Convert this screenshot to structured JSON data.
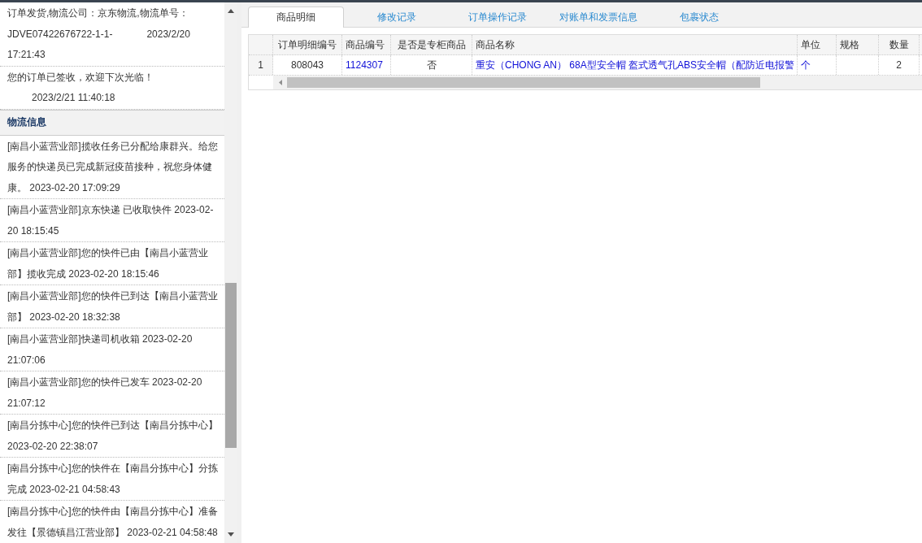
{
  "order_log": [
    {
      "text": "订单发货,物流公司：京东物流,物流单号：JDVE07422676722-1-1-",
      "time": "2023/2/20 17:21:43",
      "kind": "inline"
    },
    {
      "text": "您的订单已签收，欢迎下次光临！",
      "time": "2023/2/21 11:40:18",
      "kind": "block"
    }
  ],
  "logistics": {
    "title": "物流信息",
    "entries": [
      "[南昌小蓝营业部]揽收任务已分配给康群兴。给您服务的快递员已完成新冠疫苗接种，祝您身体健康。 2023-02-20 17:09:29",
      "[南昌小蓝营业部]京东快递 已收取快件 2023-02-20 18:15:45",
      "[南昌小蓝营业部]您的快件已由【南昌小蓝营业部】揽收完成 2023-02-20 18:15:46",
      "[南昌小蓝营业部]您的快件已到达【南昌小蓝营业部】 2023-02-20 18:32:38",
      "[南昌小蓝营业部]快递司机收箱 2023-02-20 21:07:06",
      "[南昌小蓝营业部]您的快件已发车 2023-02-20 21:07:12",
      "[南昌分拣中心]您的快件已到达【南昌分拣中心】 2023-02-20 22:38:07",
      "[南昌分拣中心]您的快件在【南昌分拣中心】分拣完成 2023-02-21 04:58:43",
      "[南昌分拣中心]您的快件由【南昌分拣中心】准备发往【景德镇昌江营业部】 2023-02-21 04:58:48"
    ]
  },
  "tabs": [
    {
      "label": "商品明细",
      "selected": true
    },
    {
      "label": "修改记录",
      "selected": false
    },
    {
      "label": "订单操作记录",
      "selected": false
    },
    {
      "label": "对账单和发票信息",
      "selected": false
    },
    {
      "label": "包裹状态",
      "selected": false
    }
  ],
  "table": {
    "columns": [
      "订单明细编号",
      "商品编号",
      "是否是专柜商品",
      "商品名称",
      "单位",
      "规格",
      "数量"
    ],
    "rows": [
      {
        "row_number": "1",
        "cells": [
          "808043",
          "1124307",
          "否",
          "重安（CHONG AN） 68A型安全帽 盔式透气孔ABS安全帽（配防近电报警",
          "个",
          "",
          "2"
        ]
      }
    ]
  }
}
